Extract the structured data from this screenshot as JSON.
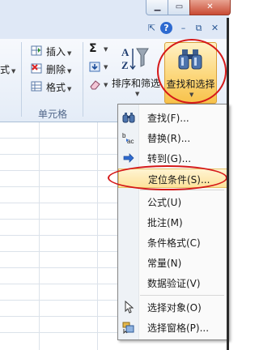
{
  "ribbon": {
    "partial_left_label": "式",
    "cells_group": {
      "insert_label": "插入",
      "delete_label": "删除",
      "format_label": "格式",
      "group_label": "单元格"
    },
    "editing": {
      "sum_label": "Σ",
      "sort_filter_label": "排序和筛选",
      "find_select_label": "查找和选择"
    }
  },
  "menu": {
    "items": [
      {
        "label": "查找(F)...",
        "icon": "binoculars-icon"
      },
      {
        "label": "替换(R)...",
        "icon": "replace-icon"
      },
      {
        "label": "转到(G)...",
        "icon": "arrow-right-icon"
      },
      {
        "label": "定位条件(S)...",
        "icon": ""
      },
      {
        "label": "公式(U)",
        "icon": ""
      },
      {
        "label": "批注(M)",
        "icon": ""
      },
      {
        "label": "条件格式(C)",
        "icon": ""
      },
      {
        "label": "常量(N)",
        "icon": ""
      },
      {
        "label": "数据验证(V)",
        "icon": ""
      },
      {
        "label": "选择对象(O)",
        "icon": "pointer-icon"
      },
      {
        "label": "选择窗格(P)...",
        "icon": "selection-pane-icon"
      }
    ],
    "highlighted_index": 3
  },
  "colors": {
    "annotation_red": "#d51818",
    "highlight": "#fde29b"
  }
}
